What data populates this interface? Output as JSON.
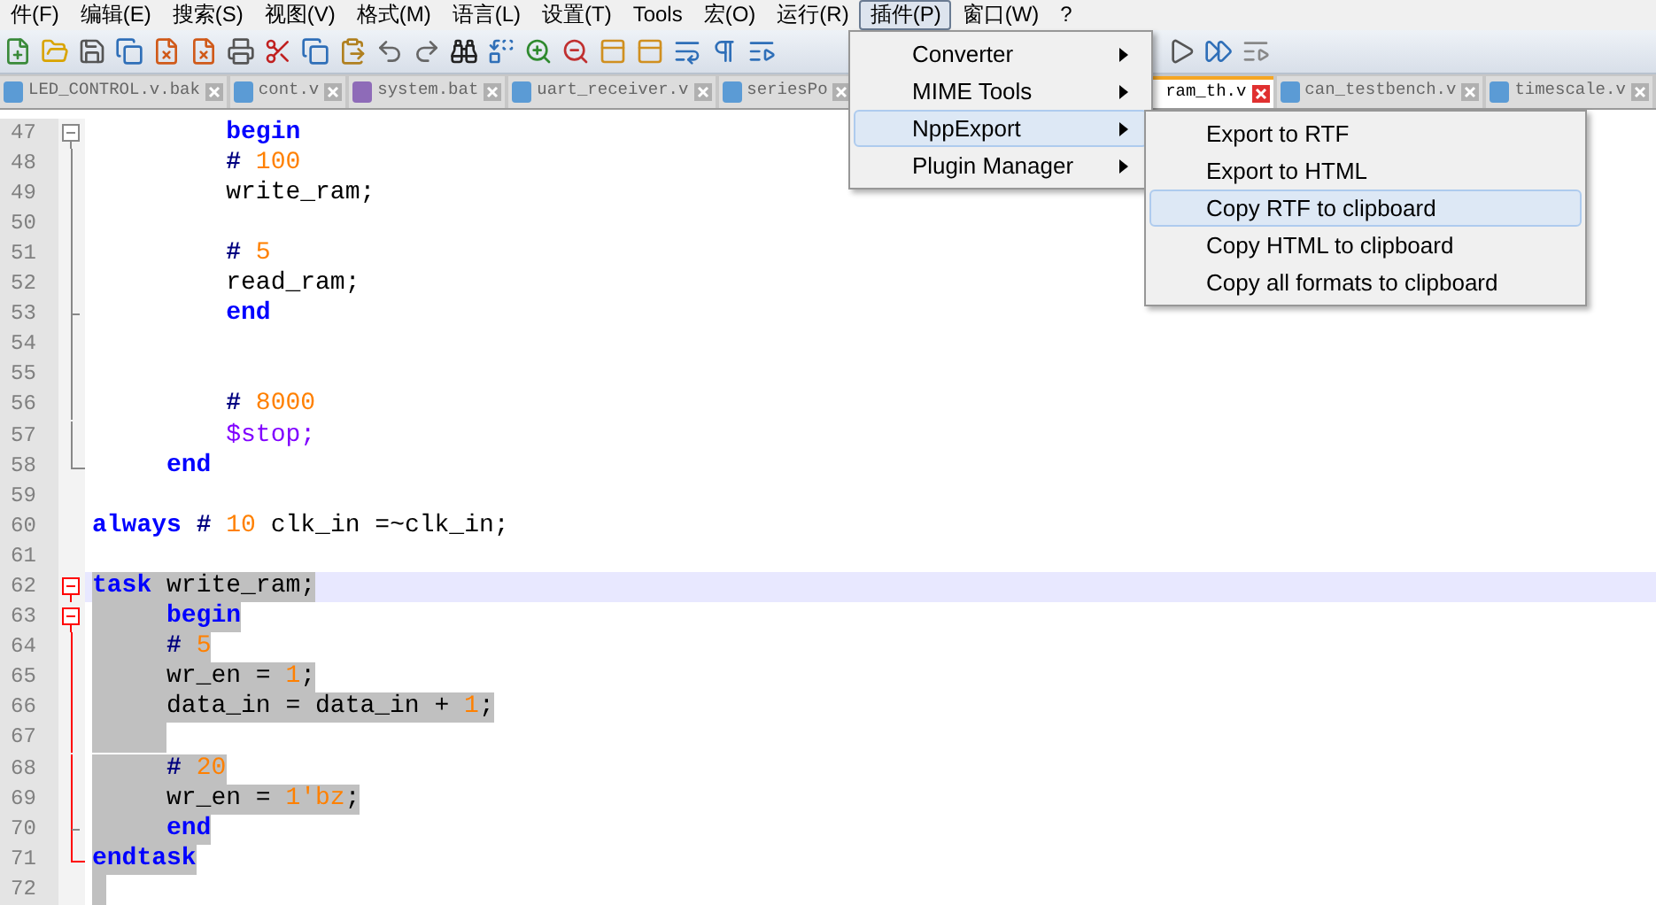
{
  "menu_bar": [
    {
      "label": "件(F)",
      "selected": false
    },
    {
      "label": "编辑(E)",
      "selected": false
    },
    {
      "label": "搜索(S)",
      "selected": false
    },
    {
      "label": "视图(V)",
      "selected": false
    },
    {
      "label": "格式(M)",
      "selected": false
    },
    {
      "label": "语言(L)",
      "selected": false
    },
    {
      "label": "设置(T)",
      "selected": false
    },
    {
      "label": "Tools",
      "selected": false
    },
    {
      "label": "宏(O)",
      "selected": false
    },
    {
      "label": "运行(R)",
      "selected": false
    },
    {
      "label": "插件(P)",
      "selected": true
    },
    {
      "label": "窗口(W)",
      "selected": false
    },
    {
      "label": "?",
      "selected": false
    }
  ],
  "tabs": [
    {
      "label": "LED_CONTROL.v.bak",
      "selected": false,
      "covered": false,
      "color": "#5b9bd5"
    },
    {
      "label": "cont.v",
      "selected": false,
      "covered": false,
      "color": "#5b9bd5"
    },
    {
      "label": "system.bat",
      "selected": false,
      "covered": false,
      "color": "#8e6bb8"
    },
    {
      "label": "uart_receiver.v",
      "selected": false,
      "covered": false,
      "color": "#5b9bd5"
    },
    {
      "label": "seriesPo",
      "selected": false,
      "covered": true,
      "color": "#5b9bd5"
    },
    {
      "label": "ram_th.v",
      "selected": true,
      "covered": true
    },
    {
      "label": "can_testbench.v",
      "selected": false,
      "covered": false,
      "color": "#5b9bd5"
    },
    {
      "label": "timescale.v",
      "selected": false,
      "covered": false,
      "color": "#5b9bd5"
    }
  ],
  "editor": {
    "lines": [
      {
        "number": "47",
        "fold": {
          "kind": "open"
        },
        "selected": false,
        "current": false,
        "tokens": [
          {
            "text": "         begin",
            "kind": "keyword"
          }
        ]
      },
      {
        "number": "48",
        "fold": {
          "kind": "line"
        },
        "selected": false,
        "current": false,
        "tokens": [
          {
            "text": "         #",
            "kind": "operator"
          },
          {
            "text": " 100",
            "kind": "number"
          }
        ]
      },
      {
        "number": "49",
        "fold": {
          "kind": "line"
        },
        "selected": false,
        "current": false,
        "tokens": [
          {
            "text": "         write_ram;",
            "kind": "identifier"
          }
        ]
      },
      {
        "number": "50",
        "fold": {
          "kind": "line"
        },
        "selected": false,
        "current": false
      },
      {
        "number": "51",
        "fold": {
          "kind": "line"
        },
        "selected": false,
        "current": false,
        "tokens": [
          {
            "text": "         #",
            "kind": "operator"
          },
          {
            "text": " 5",
            "kind": "number"
          }
        ]
      },
      {
        "number": "52",
        "fold": {
          "kind": "line"
        },
        "selected": false,
        "current": false,
        "tokens": [
          {
            "text": "         read_ram;",
            "kind": "identifier"
          }
        ]
      },
      {
        "number": "53",
        "fold": {
          "kind": "tick"
        },
        "selected": false,
        "current": false,
        "tokens": [
          {
            "text": "         end",
            "kind": "keyword"
          }
        ]
      },
      {
        "number": "54",
        "fold": {
          "kind": "line"
        },
        "selected": false,
        "current": false
      },
      {
        "number": "55",
        "fold": {
          "kind": "line"
        },
        "selected": false,
        "current": false
      },
      {
        "number": "56",
        "fold": {
          "kind": "line"
        },
        "selected": false,
        "current": false,
        "tokens": [
          {
            "text": "         #",
            "kind": "operator"
          },
          {
            "text": " 8000",
            "kind": "number"
          }
        ]
      },
      {
        "number": "57",
        "fold": {
          "kind": "line"
        },
        "selected": false,
        "current": false,
        "tokens": [
          {
            "text": "         $stop;",
            "kind": "system"
          }
        ]
      },
      {
        "number": "58",
        "fold": {
          "kind": "end"
        },
        "selected": false,
        "current": false,
        "tokens": [
          {
            "text": "     end",
            "kind": "keyword"
          }
        ]
      },
      {
        "number": "59",
        "selected": false,
        "current": false
      },
      {
        "number": "60",
        "selected": false,
        "current": false,
        "tokens": [
          {
            "text": "always",
            "kind": "keyword"
          },
          {
            "text": " #",
            "kind": "operator"
          },
          {
            "text": " 10",
            "kind": "number"
          },
          {
            "text": " clk_in =~clk_in;",
            "kind": "identifier"
          }
        ]
      },
      {
        "number": "61",
        "selected": false,
        "current": false
      },
      {
        "number": "62",
        "fold": {
          "kind": "open"
        },
        "selected": true,
        "current": true,
        "tokens": [
          {
            "text": "task",
            "kind": "keyword"
          },
          {
            "text": " write_ram;",
            "kind": "identifier"
          }
        ]
      },
      {
        "number": "63",
        "fold": {
          "kind": "open"
        },
        "selected": true,
        "current": false,
        "tokens": [
          {
            "text": "     begin",
            "kind": "keyword"
          }
        ]
      },
      {
        "number": "64",
        "fold": {
          "kind": "line"
        },
        "selected": true,
        "current": false,
        "tokens": [
          {
            "text": "     #",
            "kind": "operator"
          },
          {
            "text": " 5",
            "kind": "number"
          }
        ]
      },
      {
        "number": "65",
        "fold": {
          "kind": "line"
        },
        "selected": true,
        "current": false,
        "tokens": [
          {
            "text": "     wr_en = ",
            "kind": "identifier"
          },
          {
            "text": "1",
            "kind": "number"
          },
          {
            "text": ";",
            "kind": "identifier"
          }
        ]
      },
      {
        "number": "66",
        "fold": {
          "kind": "line"
        },
        "selected": true,
        "current": false,
        "tokens": [
          {
            "text": "     data_in = data_in + ",
            "kind": "identifier"
          },
          {
            "text": "1",
            "kind": "number"
          },
          {
            "text": ";",
            "kind": "identifier"
          }
        ]
      },
      {
        "number": "67",
        "fold": {
          "kind": "line"
        },
        "selected": true,
        "current": false
      },
      {
        "number": "68",
        "fold": {
          "kind": "line"
        },
        "selected": true,
        "current": false,
        "tokens": [
          {
            "text": "     #",
            "kind": "operator"
          },
          {
            "text": " 20",
            "kind": "number"
          }
        ]
      },
      {
        "number": "69",
        "fold": {
          "kind": "line"
        },
        "selected": true,
        "current": false,
        "tokens": [
          {
            "text": "     wr_en = ",
            "kind": "identifier"
          },
          {
            "text": "1'bz",
            "kind": "number"
          },
          {
            "text": ";",
            "kind": "identifier"
          }
        ]
      },
      {
        "number": "70",
        "fold": {
          "kind": "tick"
        },
        "selected": true,
        "current": false,
        "tokens": [
          {
            "text": "     end",
            "kind": "keyword"
          }
        ]
      },
      {
        "number": "71",
        "fold": {
          "kind": "end"
        },
        "selected": true,
        "current": false,
        "tokens": [
          {
            "text": "endtask",
            "kind": "keyword"
          }
        ]
      },
      {
        "number": "72",
        "selected": true,
        "current": false
      }
    ]
  },
  "plugin_menu": [
    {
      "label": "Converter",
      "selected": false
    },
    {
      "label": "MIME Tools",
      "selected": false
    },
    {
      "label": "NppExport",
      "selected": true
    },
    {
      "label": "Plugin Manager",
      "selected": false
    }
  ],
  "submenu": [
    {
      "label": "Export to RTF",
      "selected": false
    },
    {
      "label": "Export to HTML",
      "selected": false
    },
    {
      "label": "Copy RTF to clipboard",
      "selected": true
    },
    {
      "label": "Copy HTML to clipboard",
      "selected": false
    },
    {
      "label": "Copy all formats to clipboard",
      "selected": false
    }
  ]
}
